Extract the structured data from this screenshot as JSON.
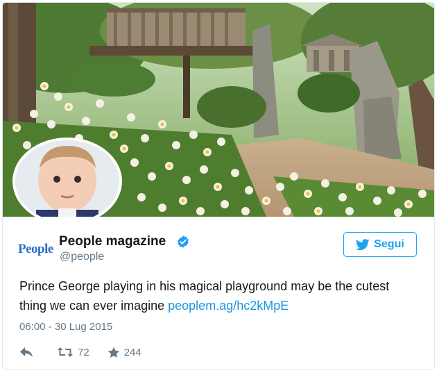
{
  "tweet": {
    "author_name": "People magazine",
    "author_handle": "@people",
    "logo_text": "People",
    "follow_label": "Segui",
    "text_prefix": "Prince George playing in his magical playground may be the cutest thing we can ever imagine",
    "link_text": "peoplem.ag/hc2kMpE",
    "timestamp": "06:00 - 30 Lug 2015",
    "retweet_count": "72",
    "like_count": "244"
  },
  "icons": {
    "verified": "verified-badge-icon",
    "twitter_bird": "twitter-bird-icon",
    "reply": "reply-icon",
    "retweet": "retweet-icon",
    "like": "star-icon"
  },
  "colors": {
    "accent": "#1da1f2",
    "link": "#1b95e0",
    "muted": "#657786",
    "text": "#14171a",
    "logo": "#2d6fc3"
  }
}
